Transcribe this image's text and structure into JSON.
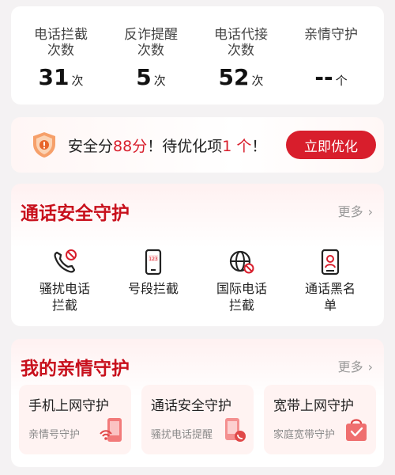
{
  "stats": [
    {
      "label_line1": "电话拦截",
      "label_line2": "次数",
      "value": "31",
      "unit": "次"
    },
    {
      "label_line1": "反诈提醒",
      "label_line2": "次数",
      "value": "5",
      "unit": "次"
    },
    {
      "label_line1": "电话代接",
      "label_line2": "次数",
      "value": "52",
      "unit": "次"
    },
    {
      "label_line1": "亲情守护",
      "label_line2": "",
      "value": "--",
      "unit": "个"
    }
  ],
  "safety": {
    "prefix": "安全分",
    "score": "88分",
    "mid": "！待优化项",
    "count": "1 个",
    "suffix": "！",
    "button": "立即优化"
  },
  "call_protection": {
    "title": "通话安全守护",
    "more": "更多",
    "items": [
      {
        "line1": "骚扰电话",
        "line2": "拦截",
        "icon": "phone-block-icon"
      },
      {
        "line1": "号段拦截",
        "line2": "",
        "icon": "number-segment-icon"
      },
      {
        "line1": "国际电话",
        "line2": "拦截",
        "icon": "globe-block-icon"
      },
      {
        "line1": "通话黑名",
        "line2": "单",
        "icon": "blacklist-icon"
      }
    ]
  },
  "family_protection": {
    "title": "我的亲情守护",
    "more": "更多",
    "tiles": [
      {
        "title": "手机上网守护",
        "subtitle": "亲情号守护",
        "icon": "phone-wifi-icon"
      },
      {
        "title": "通话安全守护",
        "subtitle": "骚扰电话提醒",
        "icon": "call-shield-icon"
      },
      {
        "title": "宽带上网守护",
        "subtitle": "家庭宽带守护",
        "icon": "broadband-bag-icon"
      }
    ]
  },
  "colors": {
    "accent": "#d81e2c",
    "title_red": "#c8101c"
  }
}
